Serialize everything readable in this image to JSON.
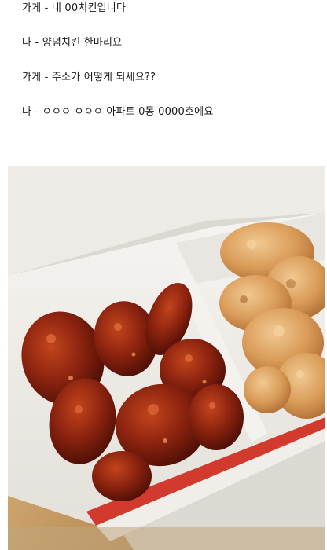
{
  "dialogue": [
    {
      "text": "가게 - 네 00치킨입니다"
    },
    {
      "text": "나 - 양념치킨 한마리요"
    },
    {
      "text": "가게 - 주소가 어떻게 되세요??"
    },
    {
      "text": "나 - ㅇㅇㅇ ㅇㅇㅇ 아파트 0동 0000호에요"
    }
  ],
  "photo": {
    "colors": {
      "box_white": "#f3f1ee",
      "box_shadow": "#d9d5cf",
      "red_stripe": "#d23a2e",
      "table_wood": "#c9a26a",
      "sauce_dark": "#5a1206",
      "sauce_mid": "#8e2410",
      "sauce_light": "#c2451c",
      "fried_dark": "#b9743a",
      "fried_mid": "#d99b58",
      "fried_light": "#efc48a"
    }
  }
}
